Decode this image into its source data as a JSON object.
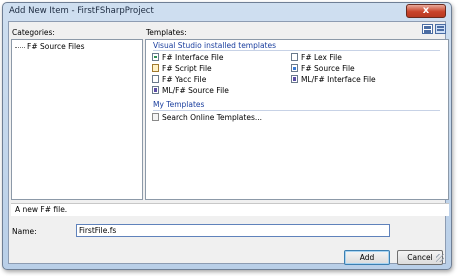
{
  "window": {
    "title": "Add New Item - FirstFSharpProject",
    "close_glyph": "x"
  },
  "categories": {
    "label": "Categories:",
    "items": [
      {
        "label": "F# Source Files"
      }
    ]
  },
  "templates": {
    "label": "Templates:",
    "installed_header": "Visual Studio installed templates",
    "installed": [
      {
        "label": "F# Interface File",
        "icon": "interface-file-icon"
      },
      {
        "label": "F# Lex File",
        "icon": "file-icon"
      },
      {
        "label": "F# Script File",
        "icon": "script-file-icon"
      },
      {
        "label": "F# Source File",
        "icon": "fsharp-file-icon"
      },
      {
        "label": "F# Yacc File",
        "icon": "file-icon"
      },
      {
        "label": "ML/F# Interface File",
        "icon": "ml-interface-file-icon"
      },
      {
        "label": "ML/F# Source File",
        "icon": "ml-source-file-icon"
      }
    ],
    "my_header": "My Templates",
    "my": [
      {
        "label": "Search Online Templates...",
        "icon": "search-online-icon"
      }
    ]
  },
  "description": "A new F# file.",
  "name_field": {
    "label": "Name:",
    "value": "FirstFile.fs"
  },
  "buttons": {
    "add": "Add",
    "cancel": "Cancel"
  }
}
